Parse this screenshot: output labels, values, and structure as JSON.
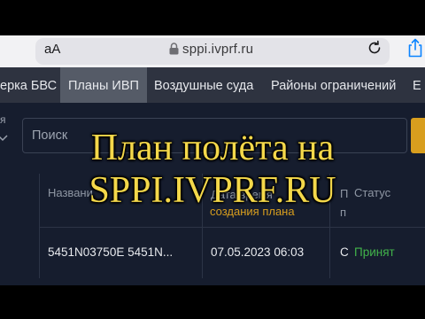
{
  "browser": {
    "text_size_label": "aA",
    "url": "sppi.ivprf.ru",
    "icons": [
      "lock-icon",
      "reload-icon",
      "share-icon"
    ]
  },
  "nav": {
    "items": [
      {
        "label": "ерка БВС",
        "active": false
      },
      {
        "label": "Планы ИВП",
        "active": true
      },
      {
        "label": "Воздушные суда",
        "active": false
      },
      {
        "label": "Районы ограничений",
        "active": false
      },
      {
        "label": "Е",
        "active": false
      }
    ]
  },
  "filter": {
    "left_label": "я",
    "search_placeholder": "Поиск"
  },
  "table": {
    "col_name": "Названи",
    "col_date": "Дата/время",
    "col_date_link": "создания плана",
    "col_partial": "П",
    "col_partial2": "п",
    "col_status": "Статус",
    "row": {
      "name": "5451N03750E 5451N...",
      "date": "07.05.2023 06:03",
      "partial": "С",
      "status": "Принят"
    }
  },
  "overlay": {
    "line1": "План полёта на",
    "line2": "SPPI.IVPRF.RU"
  },
  "colors": {
    "nav_bg": "#2e3340",
    "panel_bg": "#161d2e",
    "accent": "#d89e1e",
    "status_green": "#41b34a",
    "overlay_text": "#f4d84a"
  }
}
